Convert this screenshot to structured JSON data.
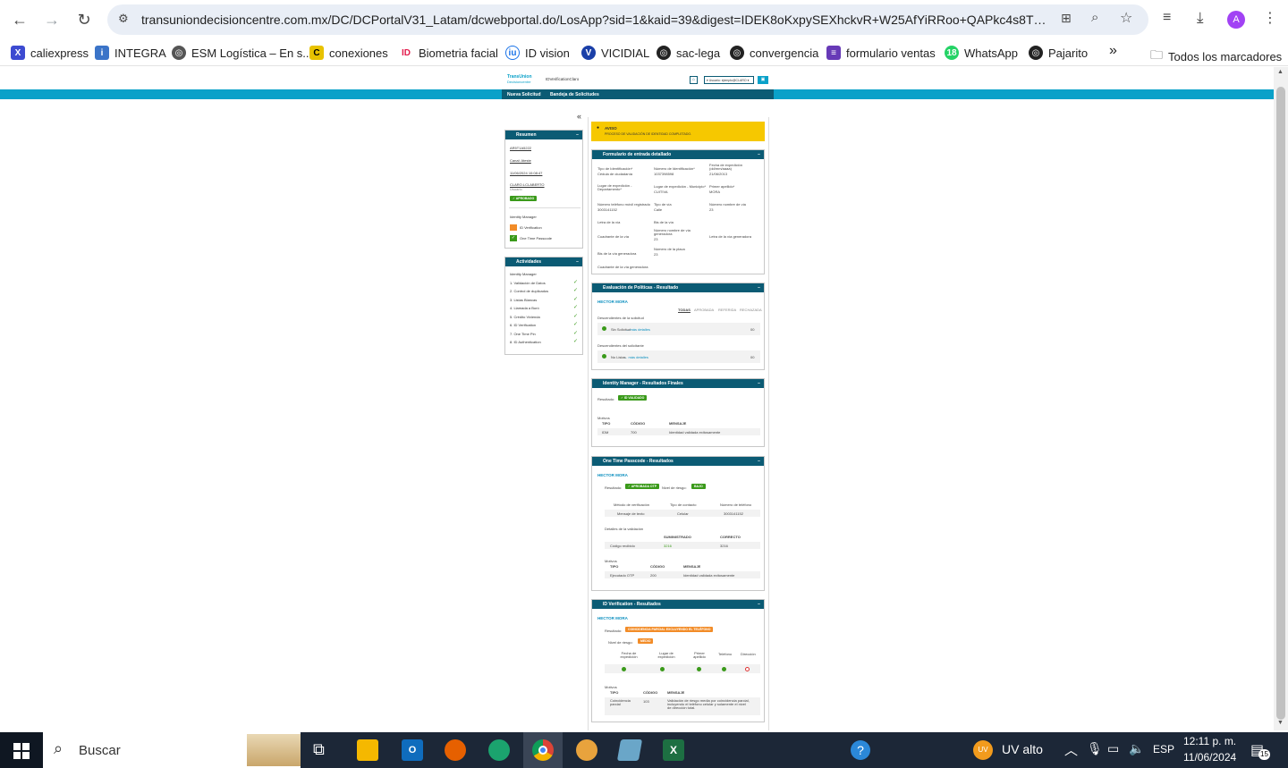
{
  "browser": {
    "url": "transuniondecisioncentre.com.mx/DC/DCPortalV31_Latam/dcwebportal.do/LosApp?sid=1&kaid=39&digest=IDEK8oKxpySEXhckvR+W25AfYiRRoo+QAPkc4s8TNmE...",
    "profile_initial": "A",
    "bookmarks": [
      "caliexpress",
      "INTEGRA",
      "ESM Logística – En s...",
      "conexiones",
      "Biometria facial",
      "ID vision",
      "VICIDIAL",
      "sac-lega",
      "convergencia",
      "formulario ventas",
      "WhatsApp",
      "Pajarito"
    ],
    "all_bookmarks": "Todos los marcadores",
    "overflow": "»"
  },
  "app": {
    "logo_line1": "TransUnion",
    "logo_line2": "Decisioncentre",
    "app_name": "IDVerificationClaro",
    "user_select": "▾ Usuario: ejemplo@CLARO ▾",
    "nav": [
      "Nueva Solicitud",
      "Bandeja de Solicitudes"
    ],
    "collapse": "«"
  },
  "resumen": {
    "title": "Resumen",
    "minus": "−",
    "id1": "AR5T1A5222",
    "field2": "Canal: Ateste",
    "date": "11/06/2024 10:08:47",
    "user": "CLARO.LCLABERTO",
    "user_sub": "Usuario",
    "status": "✓ APROBADO",
    "im_label": "Identity Manager",
    "im_items": [
      "ID Verification",
      "One Time Passcode"
    ]
  },
  "actividades": {
    "title": "Actividades",
    "minus": "−",
    "header": "Identity Manager",
    "items": [
      "1.  Validación de Datos",
      "2.  Control de duplicados",
      "3.  Listas Blancas",
      "4.  Llamada a Buró",
      "5.  Crédito Vivienda",
      "6.  ID Verification",
      "7.  One Time Pin",
      "8.  ID Authentication"
    ]
  },
  "aviso": {
    "title": "AVISO",
    "text": "PROCESO DE VALIDACIÓN DE IDENTIDAD COMPLETADO."
  },
  "formulario": {
    "title": "Formulario de entrada detallado",
    "minus": "−",
    "fields": [
      {
        "label": "Tipo de Identificación*",
        "value": "Cédula de ciudadanía"
      },
      {
        "label": "Número de Identificación*",
        "value": "1037398598"
      },
      {
        "label": "Fecha de expedición (dd/mm/aaaa)",
        "value": "21/06/2013"
      },
      {
        "label": "Lugar de expedición - Departamento*",
        "value": ""
      },
      {
        "label": "Lugar de expedición - Municipio*",
        "value": "CUITIVA"
      },
      {
        "label": "Primer apellido*",
        "value": "MORA"
      },
      {
        "label": "Número teléfono móvil registrado",
        "value": "3003141152"
      },
      {
        "label": "Tipo de vía",
        "value": "Calle"
      },
      {
        "label": "Número nombre de vía",
        "value": "23"
      },
      {
        "label": "Letra de la vía",
        "value": ""
      },
      {
        "label": "Bis de la vía",
        "value": ""
      },
      {
        "label": "Cuadrante de la vía",
        "value": ""
      },
      {
        "label": "Número nombre de vía generadora",
        "value": "23"
      },
      {
        "label": "Letra de la vía generadora",
        "value": ""
      },
      {
        "label": "Bis de la vía generadora",
        "value": ""
      },
      {
        "label": "Número de la placa",
        "value": "23"
      },
      {
        "label": "Cuadrante de la vía generadora",
        "value": ""
      }
    ]
  },
  "politicas": {
    "title": "Evaluación de Políticas - Resultado",
    "minus": "−",
    "name": "HECTOR MORA",
    "tabs": [
      "TODAS",
      "APROBADA",
      "REFERIDA",
      "RECHAZADA"
    ],
    "group1": "Descendientes de la solicitud",
    "row1": "Sin Solicitud",
    "row1_link": "... más detalles",
    "row1_code": "00",
    "group2": "Descendientes del solicitante",
    "row2": "No Listas",
    "row2_link": "... más detalles",
    "row2_code": "00"
  },
  "im_final": {
    "title": "Identity Manager - Resultados Finales",
    "minus": "−",
    "result_label": "Resultado:",
    "result": "✓ ID VALIDADO",
    "motivos": "Motivos",
    "cols": [
      "TIPO",
      "CÓDIGO",
      "MENSAJE"
    ],
    "row": [
      "IDM",
      "700",
      "Identidad validada exitosamente"
    ]
  },
  "otp": {
    "title": "One Time Passcode - Resultados",
    "minus": "−",
    "name": "HECTOR MORA",
    "result_label": "Resultado:",
    "result": "✓ APROBADA OTP",
    "risk_label": "Nivel de riesgo:",
    "risk": "BAJO",
    "cols1": [
      "Método de verificación",
      "Tipo de contacto",
      "Número de teléfono"
    ],
    "row1": [
      "Mensaje de texto",
      "Celular",
      "3003141152"
    ],
    "detalles": "Detalles de la validación",
    "cols2": [
      "",
      "SUMINISTRADO",
      "CORRECTO"
    ],
    "row2": [
      "Código recibido",
      "3216",
      "3216"
    ],
    "motivos": "Motivos",
    "cols3": [
      "TIPO",
      "CÓDIGO",
      "MENSAJE"
    ],
    "row3": [
      "Ejecutado OTP",
      "200",
      "Identidad validada exitosamente"
    ]
  },
  "idv": {
    "title": "ID Verification - Resultados",
    "minus": "−",
    "name": "HECTOR MORA",
    "result_label": "Resultado:",
    "result": "COINCIDENCIA PARCIAL EXCLUYENDO EL TELÉFONO",
    "risk_label": "Nivel de riesgo:",
    "risk": "MEDIO",
    "cols": [
      "Fecha de expedición",
      "Lugar de expedición",
      "Primer apellido",
      "Teléfono",
      "Dirección"
    ],
    "motivos": "Motivos",
    "cols2": [
      "TIPO",
      "CÓDIGO",
      "MENSAJE"
    ],
    "row": [
      "Coincidencia parcial",
      "103",
      "Validación de riesgo media por coincidencia parcial, incluyendo el teléfono celular y solamente el nivel de dirección total."
    ]
  },
  "taskbar": {
    "search": "Buscar",
    "weather": "UV alto",
    "weather_badge": "UV",
    "lang": "ESP",
    "time": "12:11 p. m.",
    "date": "11/06/2024",
    "notif": "15"
  },
  "colors": {
    "teal": "#0aa1c9",
    "navy": "#0b5b74",
    "green": "#3a9a1a",
    "orange": "#f28c28",
    "aviso": "#f6c800"
  }
}
